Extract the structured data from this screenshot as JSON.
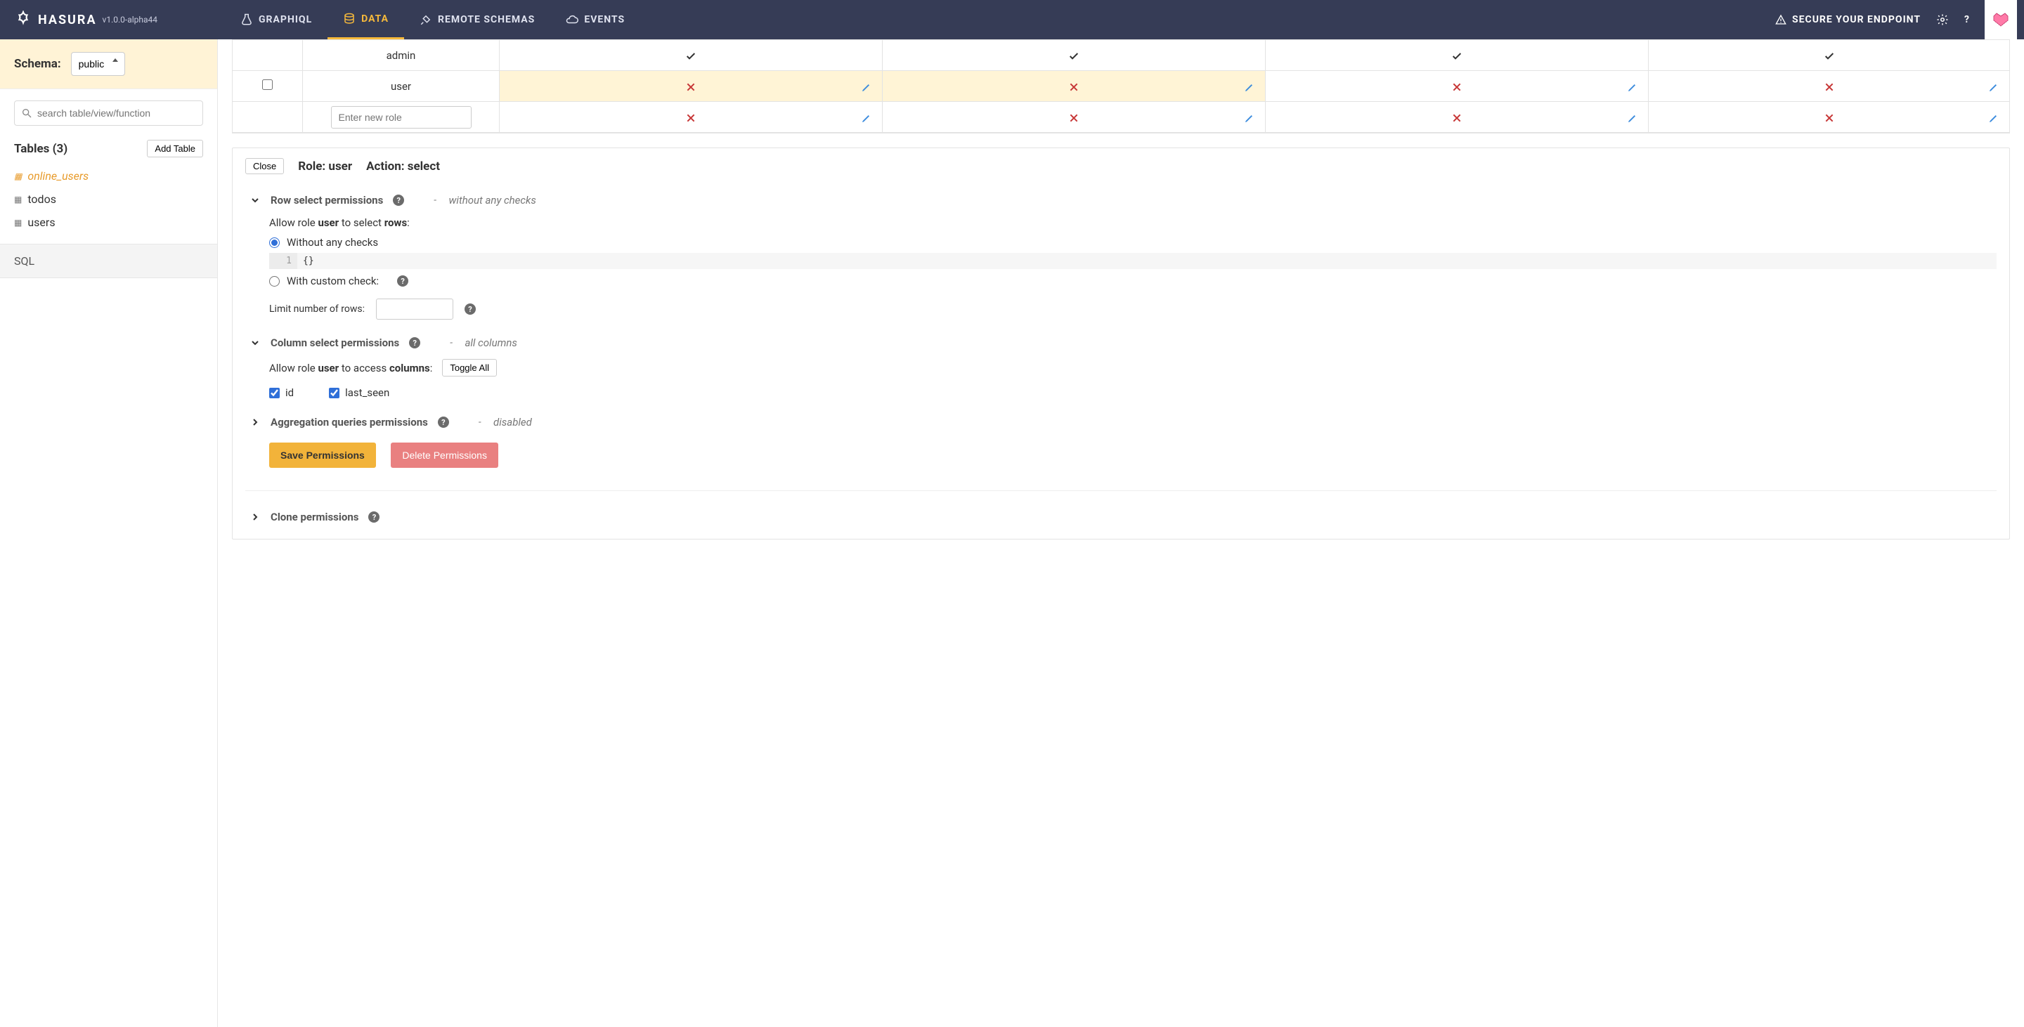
{
  "brand": {
    "name": "HASURA",
    "version": "v1.0.0-alpha44"
  },
  "nav": {
    "graphiql": "GRAPHIQL",
    "data": "DATA",
    "remote": "REMOTE SCHEMAS",
    "events": "EVENTS",
    "secure": "SECURE YOUR ENDPOINT"
  },
  "sidebar": {
    "schema_label": "Schema:",
    "schema_value": "public",
    "search_placeholder": "search table/view/function",
    "tables_heading": "Tables (3)",
    "add_table": "Add Table",
    "tables": [
      {
        "name": "online_users",
        "active": true
      },
      {
        "name": "todos",
        "active": false
      },
      {
        "name": "users",
        "active": false
      }
    ],
    "sql": "SQL"
  },
  "perm_table": {
    "roles": {
      "admin": "admin",
      "user": "user",
      "new_placeholder": "Enter new role"
    }
  },
  "panel": {
    "close": "Close",
    "role_label": "Role: user",
    "action_label": "Action: select",
    "row_section": {
      "title": "Row select permissions",
      "status": "without any checks",
      "allow_prefix": "Allow role ",
      "allow_role": "user",
      "allow_mid": " to select ",
      "allow_suffix": "rows",
      "opt_without": "Without any checks",
      "code": "{}",
      "opt_custom": "With custom check:",
      "limit_label": "Limit number of rows:"
    },
    "col_section": {
      "title": "Column select permissions",
      "status": "all columns",
      "allow_prefix": "Allow role ",
      "allow_role": "user",
      "allow_mid": " to access ",
      "allow_suffix": "columns",
      "toggle_all": "Toggle All",
      "columns": [
        "id",
        "last_seen"
      ]
    },
    "agg_section": {
      "title": "Aggregation queries permissions",
      "status": "disabled"
    },
    "clone_section": {
      "title": "Clone permissions"
    },
    "save": "Save Permissions",
    "delete": "Delete Permissions"
  }
}
